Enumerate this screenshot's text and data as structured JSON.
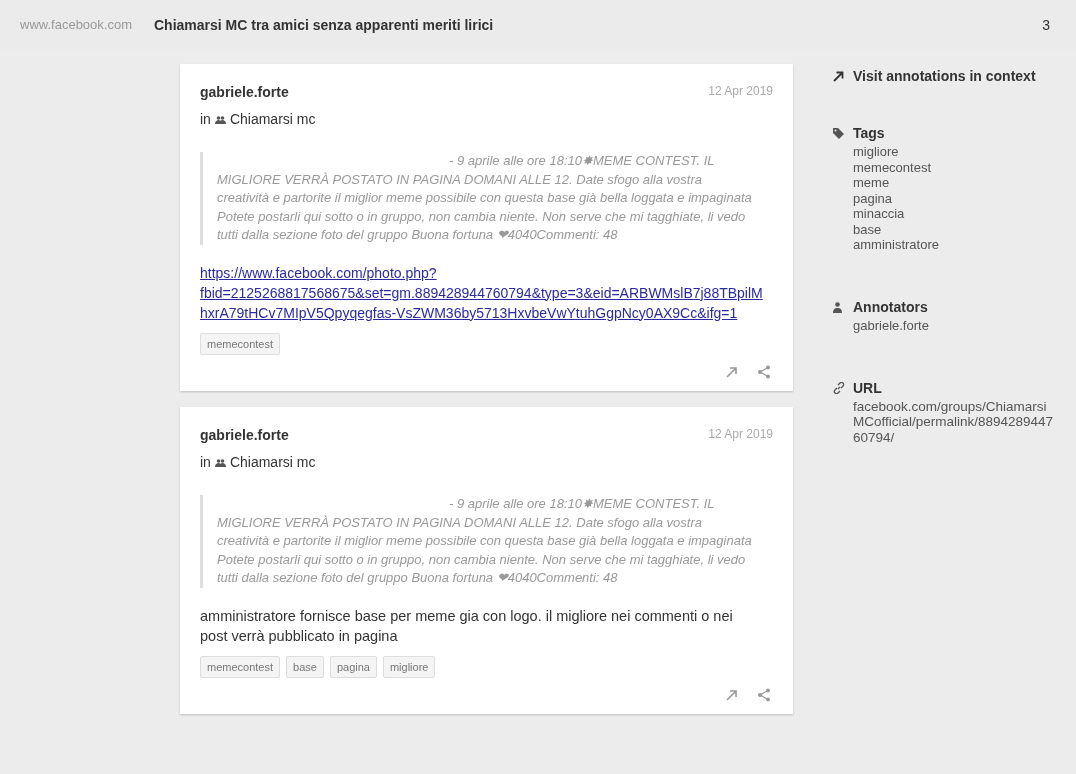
{
  "header": {
    "domain": "www.facebook.com",
    "title": "Chiamarsi MC tra amici senza apparenti meriti lirici",
    "count": "3"
  },
  "annotations": [
    {
      "user": "gabriele.forte",
      "date": "12 Apr 2019",
      "group_prefix": "in",
      "group": "Chiamarsi mc",
      "quote": "- 9 aprile alle ore 18:10✸MEME CONTEST. IL MIGLIORE VERRÀ POSTATO IN PAGINA DOMANI ALLE 12. Date sfogo alla vostra creatività e partorite il miglior meme possibile con questa base già bella loggata e impaginata Potete postarli qui sotto o in gruppo, non cambia niente. Non serve che mi tagghiate, li vedo tutti dalla sezione foto del gruppo Buona fortuna ❤4040Commenti: 48",
      "link": "https://www.facebook.com/photo.php?fbid=2125268817568675&set=gm.889428944760794&type=3&eid=ARBWMslB7j88TBpilMhxrA79tHCv7MIpV5Qpyqegfas-VsZWM36by5713HxvbeVwYtuhGgpNcy0AX9Cc&ifg=1",
      "tags": [
        "memecontest"
      ]
    },
    {
      "user": "gabriele.forte",
      "date": "12 Apr 2019",
      "group_prefix": "in",
      "group": "Chiamarsi mc",
      "quote": "- 9 aprile alle ore 18:10✸MEME CONTEST. IL MIGLIORE VERRÀ POSTATO IN PAGINA DOMANI ALLE 12. Date sfogo alla vostra creatività e partorite il miglior meme possibile con questa base già bella loggata e impaginata Potete postarli qui sotto o in gruppo, non cambia niente. Non serve che mi tagghiate, li vedo tutti dalla sezione foto del gruppo Buona fortuna ❤4040Commenti: 48",
      "text": "amministratore fornisce base per meme gia con logo. il migliore nei commenti o nei post verrà pubblicato in pagina",
      "tags": [
        "memecontest",
        "base",
        "pagina",
        "migliore"
      ]
    }
  ],
  "sidebar": {
    "visit": "Visit annotations in context",
    "tags_title": "Tags",
    "tags": [
      "migliore",
      "memecontest",
      "meme",
      "pagina",
      "minaccia",
      "base",
      "amministratore"
    ],
    "annotators_title": "Annotators",
    "annotators": [
      "gabriele.forte"
    ],
    "url_title": "URL",
    "url": "facebook.com/groups/ChiamarsiMCofficial/permalink/889428944760794/"
  }
}
